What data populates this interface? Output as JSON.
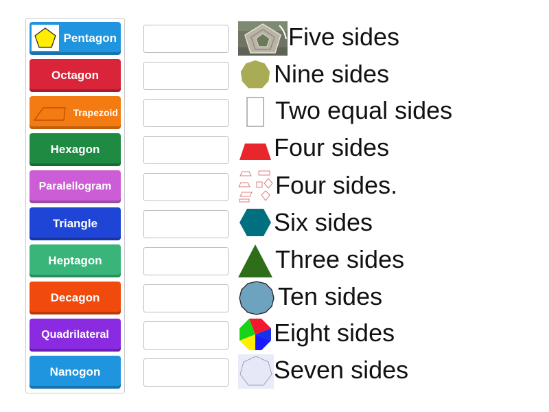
{
  "tiles": [
    {
      "label": "Pentagon",
      "color": "#1f95e0"
    },
    {
      "label": "Octagon",
      "color": "#d9243a"
    },
    {
      "label": "Trapezoid",
      "color": "#f47b12"
    },
    {
      "label": "Hexagon",
      "color": "#1e8a42"
    },
    {
      "label": "Paralellogram",
      "color": "#cc5dd6"
    },
    {
      "label": "Triangle",
      "color": "#1f45d6"
    },
    {
      "label": "Heptagon",
      "color": "#39b57a"
    },
    {
      "label": "Decagon",
      "color": "#f04a0c"
    },
    {
      "label": "Quadrilateral",
      "color": "#8a2be2"
    },
    {
      "label": "Nanogon",
      "color": "#1f95e0"
    }
  ],
  "items": [
    {
      "text": "Five sides",
      "image": "pentagon-building-photo"
    },
    {
      "text": "Nine sides",
      "image": "olive-nonagon"
    },
    {
      "text": "Two equal sides",
      "image": "tall-rectangle-outline"
    },
    {
      "text": "Four sides",
      "image": "red-trapezoid"
    },
    {
      "text": "Four sides.",
      "image": "quadrilateral-sketches"
    },
    {
      "text": "Six sides",
      "image": "teal-hexagon"
    },
    {
      "text": "Three sides",
      "image": "green-triangle"
    },
    {
      "text": "Ten sides",
      "image": "blue-decagon"
    },
    {
      "text": "Eight sides",
      "image": "multicolor-octagon"
    },
    {
      "text": "Seven sides",
      "image": "lavender-heptagon"
    }
  ]
}
